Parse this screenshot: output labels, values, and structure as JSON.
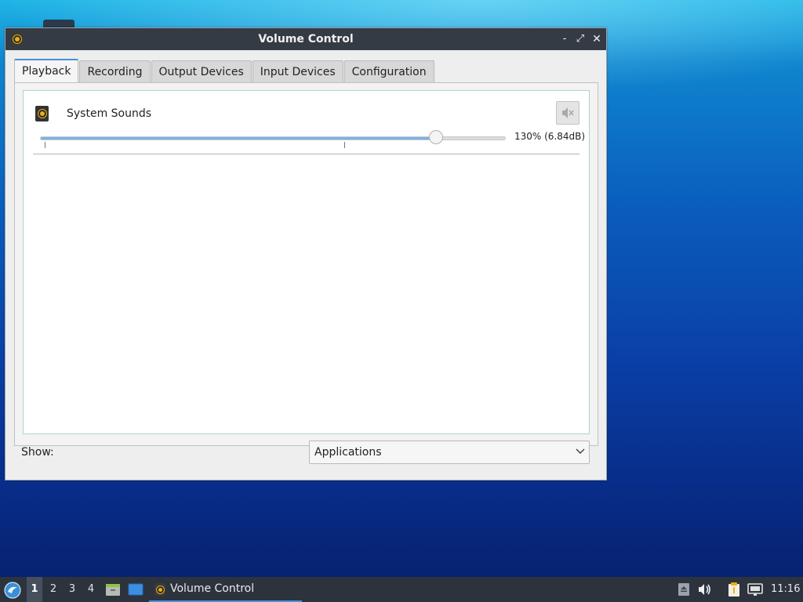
{
  "window": {
    "title": "Volume Control",
    "controls": {
      "minimize": "-",
      "maximize": "⤢",
      "close": "✕"
    }
  },
  "tabs": [
    {
      "label": "Playback",
      "active": true
    },
    {
      "label": "Recording",
      "active": false
    },
    {
      "label": "Output Devices",
      "active": false
    },
    {
      "label": "Input Devices",
      "active": false
    },
    {
      "label": "Configuration",
      "active": false
    }
  ],
  "playback": {
    "stream": {
      "name": "System Sounds",
      "icon": "speaker-icon",
      "volume_percent": 130,
      "volume_readout": "130% (6.84dB)",
      "muted": false,
      "slider": {
        "min_percent": 0,
        "max_percent": 153,
        "marks_percent": [
          0,
          100
        ]
      }
    }
  },
  "footer": {
    "show_label": "Show:",
    "show_value": "Applications"
  },
  "taskbar": {
    "workspaces": [
      "1",
      "2",
      "3",
      "4"
    ],
    "active_workspace": "1",
    "task_label": "Volume Control",
    "clock": "11:16"
  },
  "colors": {
    "accent": "#4a90d9",
    "slider_fill": "#7cb3e8",
    "titlebar": "#353b45",
    "taskbar": "#2c333d"
  }
}
